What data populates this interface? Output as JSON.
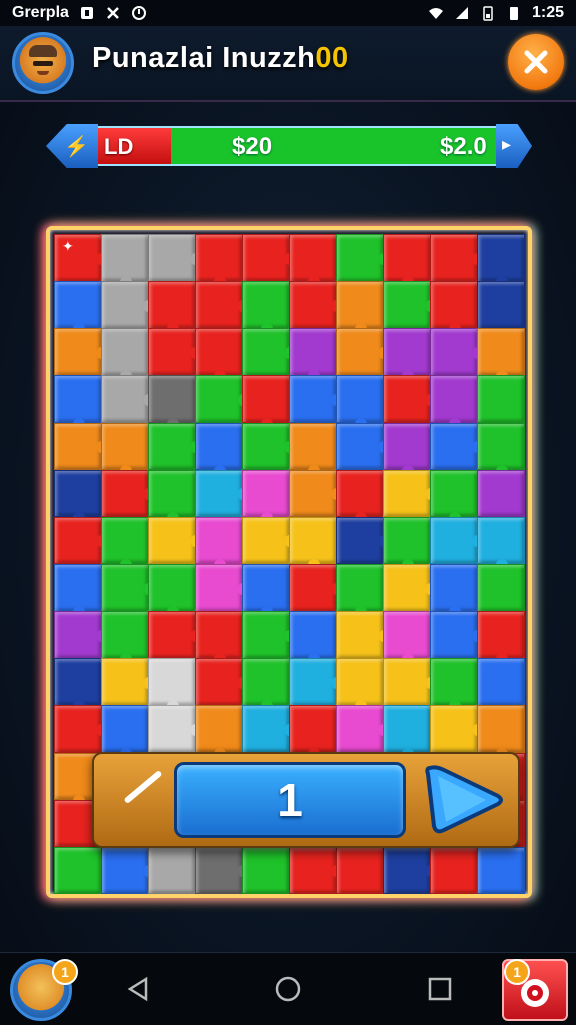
{
  "status_bar": {
    "left_text": "Grerpla",
    "time": "1:25"
  },
  "header": {
    "title_main": "Punazlai Inuzzh",
    "title_number": "00"
  },
  "progress": {
    "left_label": "LD",
    "middle_label": "$20",
    "right_label": "$2.0",
    "fill_fraction": 0.2
  },
  "puzzle": {
    "rows": 14,
    "cols": 10,
    "colors": {
      "R": "#e8231f",
      "G": "#1fc22a",
      "B": "#2a6ff0",
      "Y": "#f6c21a",
      "O": "#f08a1a",
      "P": "#a23ad0",
      "M": "#e84ad0",
      "C": "#20b0e0",
      "S": "#a8a8a8",
      "D": "#6e6e6e",
      "W": "#d8d8d8",
      "N": "#1e3fa0"
    },
    "layout": [
      "RSSRRRGRRN",
      "BSRRGROGRN",
      "OSRRGPOPPO",
      "BSDGRBBRPG",
      "OOGBGOBPBG",
      "NRGCMORYGP",
      "RGYMYYNGCC",
      "BGGMBRGYBG",
      "PGRRGBYMBR",
      "NYWRGCYYGB",
      "RBWOCRMCYO",
      "OYGBCMMRYR",
      "RWSROBMPRR",
      "GBSDGRRNRB"
    ]
  },
  "counter": {
    "value": "1"
  },
  "nav": {
    "left_badge": "1",
    "right_badge": "1"
  }
}
